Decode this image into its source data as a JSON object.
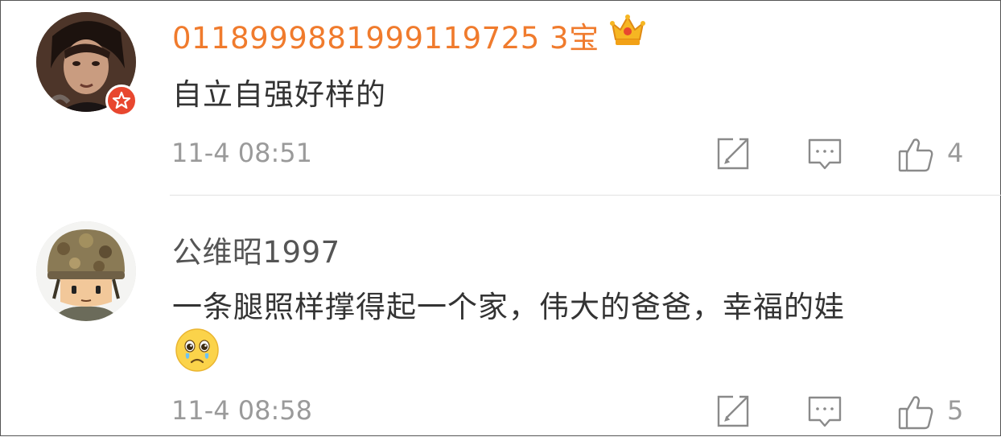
{
  "comments": [
    {
      "username": "0118999881999119725 3宝",
      "text": "自立自强好样的",
      "time": "11-4 08:51",
      "likes": "4",
      "avatar": "person-photo-avatar",
      "badges": [
        "verified-star-badge",
        "crown-icon"
      ],
      "username_color": "#f07b2d"
    },
    {
      "username": "公维昭1997",
      "text": "一条腿照样撑得起一个家，伟大的爸爸，幸福的娃",
      "time": "11-4 08:58",
      "likes": "5",
      "avatar": "soldier-cartoon-avatar",
      "emoji": "teary-face-emoji"
    }
  ],
  "actions": [
    "edit-icon",
    "reply-icon",
    "like-icon"
  ],
  "colors": {
    "accent": "#f07b2d",
    "muted": "#9a9a9a",
    "badge": "#e8472f"
  }
}
